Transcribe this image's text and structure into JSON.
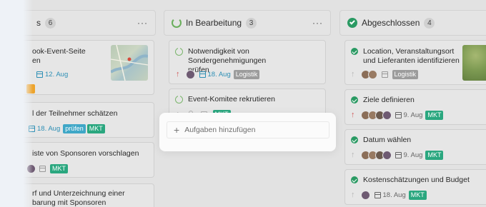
{
  "columns": [
    {
      "title": "s",
      "count": "6",
      "cards": [
        {
          "lines": [
            "ook-Event-Seite",
            "en"
          ],
          "date": "12. Aug",
          "tags": []
        },
        {
          "lines": [
            "l der Teilnehmer schätzen"
          ],
          "date": "18. Aug",
          "tags": [
            "prüfen",
            "MKT"
          ]
        },
        {
          "lines": [
            "iste von Sponsoren vorschlagen"
          ],
          "tags": [
            "MKT"
          ]
        },
        {
          "lines": [
            "rf und Unterzeichnung einer",
            "barung mit Sponsoren"
          ]
        }
      ]
    },
    {
      "title": "In Bearbeitung",
      "count": "3",
      "cards": [
        {
          "lines": [
            "Notwendigkeit von Sondergenehmigungen",
            "prüfen"
          ],
          "date": "18. Aug",
          "tags": [
            "Logistik"
          ]
        },
        {
          "lines": [
            "Event-Komitee rekrutieren"
          ],
          "tags": [
            "MKT"
          ]
        }
      ],
      "add_label": "Aufgaben hinzufügen"
    },
    {
      "title": "Abgeschlossen",
      "count": "4",
      "cards": [
        {
          "lines": [
            "Location, Veranstaltungsort",
            "und Lieferanten identifizieren"
          ],
          "tags": [
            "Logistik"
          ]
        },
        {
          "lines": [
            "Ziele definieren"
          ],
          "date": "9. Aug",
          "tags": [
            "MKT"
          ]
        },
        {
          "lines": [
            "Datum wählen"
          ],
          "date": "9. Aug",
          "tags": [
            "MKT"
          ]
        },
        {
          "lines": [
            "Kostenschätzungen und Budget"
          ],
          "date": "18. Aug",
          "tags": [
            "MKT"
          ]
        }
      ]
    }
  ],
  "more_label": "···",
  "colors": {
    "mkt": "#2aa77f",
    "logistik": "#9c9c9c",
    "pruefen": "#3fa7c7",
    "done": "#2a9a63",
    "progress": "#7ab56c",
    "date": "#2d8fb5"
  }
}
